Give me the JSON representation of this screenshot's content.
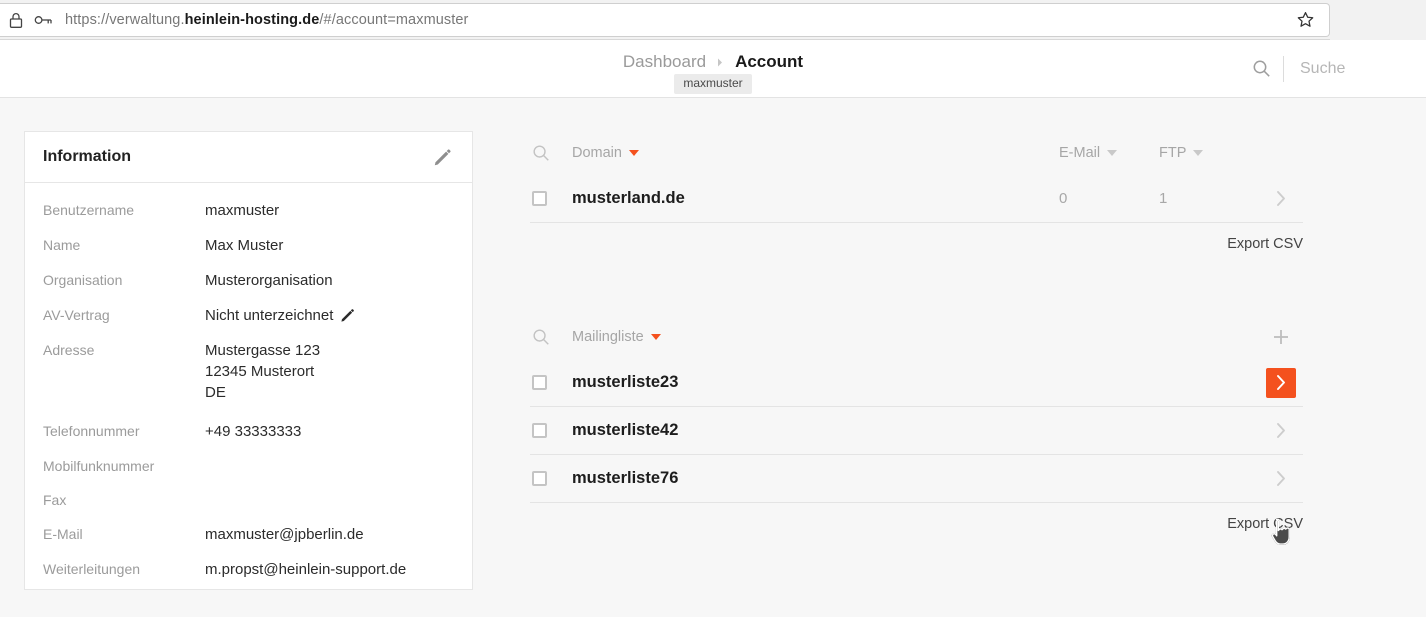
{
  "browser": {
    "url_prefix": "https://verwaltung.",
    "url_host": "heinlein-hosting.de",
    "url_suffix": "/#/account=maxmuster",
    "lock_icon": "lock-icon",
    "key_icon": "key-icon",
    "star_icon": "bookmark-star-icon"
  },
  "header": {
    "breadcrumb": {
      "root": "Dashboard",
      "separator": "▸",
      "current": "Account",
      "badge": "maxmuster"
    },
    "search": {
      "placeholder": "Suche",
      "value": "",
      "icon": "search-icon"
    }
  },
  "info_card": {
    "title": "Information",
    "edit_icon": "pencil-edit-icon",
    "rows": [
      {
        "label": "Benutzername",
        "value": "maxmuster",
        "edit": false
      },
      {
        "label": "Name",
        "value": "Max Muster",
        "edit": false
      },
      {
        "label": "Organisation",
        "value": "Musterorganisation",
        "edit": false
      },
      {
        "label": "AV-Vertrag",
        "value": "Nicht unterzeichnet",
        "edit": true
      },
      {
        "label": "Adresse",
        "value": "Mustergasse 123\n12345 Musterort\nDE",
        "edit": false
      },
      {
        "label": "Telefonnummer",
        "value": "+49 33333333",
        "edit": false
      },
      {
        "label": "Mobilfunknummer",
        "value": "",
        "edit": false
      },
      {
        "label": "Fax",
        "value": "",
        "edit": false
      },
      {
        "label": "E-Mail",
        "value": "maxmuster@jpberlin.de",
        "edit": false
      },
      {
        "label": "Weiterleitungen",
        "value": "m.propst@heinlein-support.de",
        "edit": false
      }
    ]
  },
  "domain_table": {
    "search_icon": "search-icon",
    "columns": {
      "name": "Domain",
      "email": "E-Mail",
      "ftp": "FTP"
    },
    "sort_active_column": "Domain",
    "rows": [
      {
        "name": "musterland.de",
        "email": "0",
        "ftp": "1",
        "checked": false
      }
    ],
    "export_label": "Export CSV"
  },
  "mailinglist_table": {
    "search_icon": "search-icon",
    "columns": {
      "name": "Mailingliste"
    },
    "add_icon": "plus-add-icon",
    "sort_active_column": "Mailingliste",
    "rows": [
      {
        "name": "musterliste23",
        "checked": false,
        "hover": true
      },
      {
        "name": "musterliste42",
        "checked": false,
        "hover": false
      },
      {
        "name": "musterliste76",
        "checked": false,
        "hover": false
      }
    ],
    "export_label": "Export CSV"
  },
  "colors": {
    "accent": "#F4511E",
    "page_bg": "#F7F7F7",
    "card_bg": "#FFFFFF",
    "text_primary": "#1D1D1D",
    "text_muted": "#9B9B9B",
    "border": "#E4E4E4"
  },
  "cursor": {
    "icon": "hand-pointer-cursor"
  }
}
